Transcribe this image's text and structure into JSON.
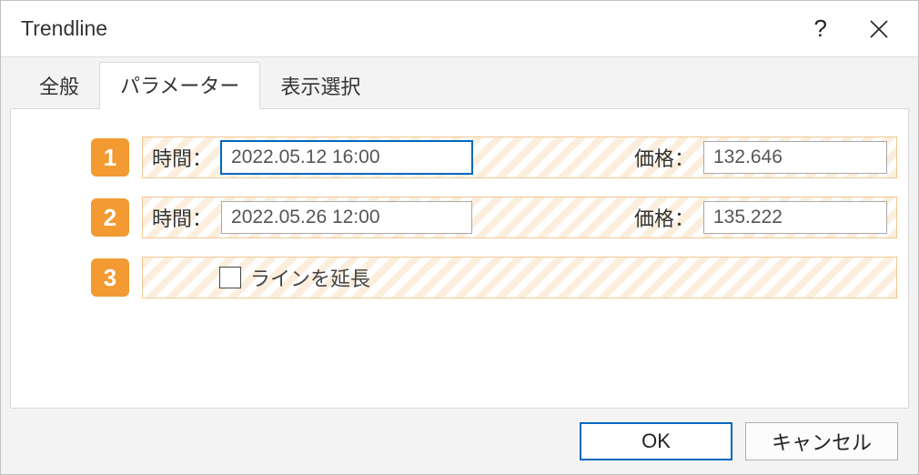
{
  "window": {
    "title": "Trendline"
  },
  "tabs": {
    "general": "全般",
    "parameters": "パラメーター",
    "display": "表示選択"
  },
  "rows": [
    {
      "badge": "1",
      "time_label": "時間：",
      "time_value": "2022.05.12 16:00",
      "price_label": "価格：",
      "price_value": "132.646"
    },
    {
      "badge": "2",
      "time_label": "時間：",
      "time_value": "2022.05.26 12:00",
      "price_label": "価格：",
      "price_value": "135.222"
    }
  ],
  "extend": {
    "badge": "3",
    "label": "ラインを延長"
  },
  "buttons": {
    "ok": "OK",
    "cancel": "キャンセル"
  }
}
